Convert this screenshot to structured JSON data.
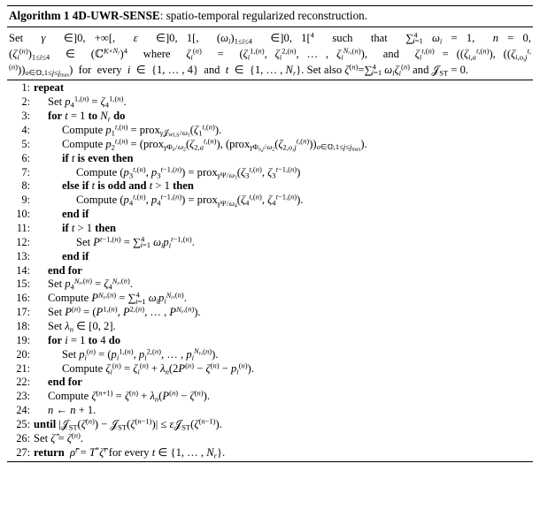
{
  "algorithm": {
    "title_label": "Algorithm 1",
    "title_name": "4D-UWR-SENSE",
    "title_desc": ": spatio-temporal regularized reconstruction.",
    "preamble": "Set γ ∈]0, +∞[, ε ∈]0, 1[, (ωi)1≤i≤4 ∈]0, 1[⁴ such that Σ⁴i=1 ωi = 1, n = 0, (ζ(n)i)1≤i≤4 ∈ (ℂ^(K×Nr))⁴ where ζ(n)i = (ζ(1,n)i, ζ(2,n)i, ..., ζ(Nr,n)i), and ζ(t,n)i = ((ζ(t,n)i,a), ((ζ(t,n)i,o,j))o∈𝕆, 1≤j≤jmax) for every i ∈ {1, ..., 4} and t ∈ {1, ..., Nr}. Set also ζ(n) = Σ⁴i=1 ωi ζ(n)i and 𝒥ST = 0.",
    "steps": [
      {
        "num": "1:",
        "indent": 1,
        "text": "repeat",
        "keywords": [
          "repeat"
        ]
      },
      {
        "num": "2:",
        "indent": 2,
        "text": "Set p4^{1,(n)} = ζ4^{1,(n)}."
      },
      {
        "num": "3:",
        "indent": 2,
        "text": "for t = 1 to Nr do",
        "keywords": [
          "for",
          "to",
          "do"
        ]
      },
      {
        "num": "4:",
        "indent": 3,
        "text": "Compute p1^{t,(n)} = prox_{γ𝒥WLS/ω1}(ζ1^{t,(n)})."
      },
      {
        "num": "5:",
        "indent": 3,
        "text": "Compute p2^{t,(n)} = (prox_{γΦa/ω2}(ζ2,a^{t,(n)}), (prox_{γΦo,j/ω2}(ζ2,o,j^{t,(n)}))o∈𝕆,1≤j≤jmax)."
      },
      {
        "num": "6:",
        "indent": 3,
        "text": "if t is even then",
        "keywords": [
          "if",
          "is even",
          "then"
        ]
      },
      {
        "num": "7:",
        "indent": 4,
        "text": "Compute (p3^{t,(n)}, p3^{t-1,(n)}) = prox_{γΨ/ω3}(ζ3^{t,(n)}, ζ3^{t-1,(n)})"
      },
      {
        "num": "8:",
        "indent": 3,
        "text": "else if t is odd and t > 1 then",
        "keywords": [
          "else if",
          "is odd and",
          "then"
        ]
      },
      {
        "num": "9:",
        "indent": 4,
        "text": "Compute (p4^{t,(n)}, p4^{t-1,(n)}) = prox_{γΨ/ω4}(ζ4^{t,(n)}, ζ4^{t-1,(n)})."
      },
      {
        "num": "10:",
        "indent": 3,
        "text": "end if",
        "keywords": [
          "end if"
        ]
      },
      {
        "num": "11:",
        "indent": 3,
        "text": "if t > 1 then",
        "keywords": [
          "if",
          "then"
        ]
      },
      {
        "num": "12:",
        "indent": 4,
        "text": "Set P^{t-1,(n)} = Σ⁴i=1 ωi pi^{t-1,(n)}."
      },
      {
        "num": "13:",
        "indent": 3,
        "text": "end if",
        "keywords": [
          "end if"
        ]
      },
      {
        "num": "14:",
        "indent": 2,
        "text": "end for",
        "keywords": [
          "end for"
        ]
      },
      {
        "num": "15:",
        "indent": 2,
        "text": "Set p4^{Nr,(n)} = ζ4^{Nr,(n)}."
      },
      {
        "num": "16:",
        "indent": 2,
        "text": "Compute P^{Nr,(n)} = Σ⁴i=1 ωi pi^{Nr,(n)}."
      },
      {
        "num": "17:",
        "indent": 2,
        "text": "Set P^{(n)} = (P^{1,(n)}, P^{2,(n)}, ..., P^{Nr,(n)})."
      },
      {
        "num": "18:",
        "indent": 2,
        "text": "Set λn ∈ [0, 2]."
      },
      {
        "num": "19:",
        "indent": 2,
        "text": "for i = 1 to 4 do",
        "keywords": [
          "for",
          "to",
          "do"
        ]
      },
      {
        "num": "20:",
        "indent": 3,
        "text": "Set pi^{(n)} = (pi^{1,(n)}, pi^{2,(n)}, ..., pi^{Nr,(n)})."
      },
      {
        "num": "21:",
        "indent": 3,
        "text": "Compute ζi^{(n)} = ζi^{(n)} + λn(2P^{(n)} - ζ^{(n)} - pi^{(n)})."
      },
      {
        "num": "22:",
        "indent": 2,
        "text": "end for",
        "keywords": [
          "end for"
        ]
      },
      {
        "num": "23:",
        "indent": 2,
        "text": "Compute ζ^{(n+1)} = ζ^{(n)} + λn(P^{(n)} - ζ^{(n)})."
      },
      {
        "num": "24:",
        "indent": 2,
        "text": "n ← n + 1."
      },
      {
        "num": "25:",
        "indent": 1,
        "text": "until |𝒥ST(ζ^{(n)}) - 𝒥ST(ζ^{(n-1)})| ≤ ε𝒥ST(ζ^{(n-1)}).",
        "keywords": [
          "until"
        ]
      },
      {
        "num": "26:",
        "indent": 1,
        "text": "Set ζ̂ = ζ^{(n)}."
      },
      {
        "num": "27:",
        "indent": 1,
        "text": "return  ρ̂^t = T*ζ̂^t for every t ∈ {1, ..., Nr}.",
        "keywords": [
          "return"
        ]
      }
    ]
  }
}
